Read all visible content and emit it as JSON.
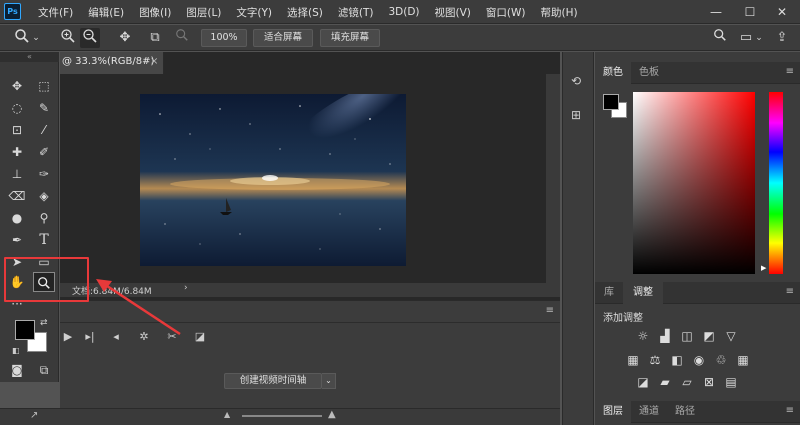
{
  "app": {
    "logo": "Ps"
  },
  "menubar": {
    "items": [
      "文件(F)",
      "编辑(E)",
      "图像(I)",
      "图层(L)",
      "文字(Y)",
      "选择(S)",
      "滤镜(T)",
      "3D(D)",
      "视图(V)",
      "窗口(W)",
      "帮助(H)"
    ],
    "minimize": "—",
    "restore": "☐",
    "close": "✕"
  },
  "options": {
    "zoom_value": "100%",
    "fit_screen": "适合屏幕",
    "fill_screen": "填充屏幕"
  },
  "document": {
    "tab_label": "@ 33.3%(RGB/8#)",
    "close": "×",
    "status": "文档:6.84M/6.84M",
    "status_chevron": "›"
  },
  "timeline": {
    "create_button": "创建视频时间轴",
    "dropdown": "⌄"
  },
  "color_panel": {
    "tabs": [
      "颜色",
      "色板"
    ],
    "foreground": "#000000",
    "background": "#ffffff"
  },
  "adjust_panel": {
    "tabs": [
      "库",
      "调整"
    ],
    "title": "添加调整"
  },
  "layers_panel": {
    "tabs": [
      "图层",
      "通道",
      "路径"
    ]
  },
  "colors": {
    "highlight": "#e8393a",
    "ps_blue": "#31a8ff"
  }
}
